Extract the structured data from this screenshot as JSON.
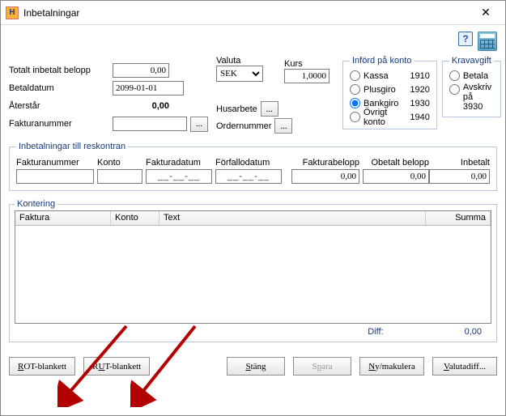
{
  "window": {
    "title": "Inbetalningar"
  },
  "labels": {
    "totalt": "Totalt inbetalt belopp",
    "betaldatum": "Betaldatum",
    "aterstar": "Återstår",
    "fakturanummer": "Fakturanummer",
    "valuta": "Valuta",
    "kurs": "Kurs",
    "husarbete": "Husarbete",
    "ordernummer": "Ordernummer"
  },
  "values": {
    "totalt": "0,00",
    "betaldatum": "2099-01-01",
    "aterstar": "0,00",
    "fakturanummer": "",
    "valuta": "SEK",
    "kurs": "1,0000"
  },
  "inford": {
    "legend": "Införd på konto",
    "options": [
      {
        "label": "Kassa",
        "acct": "1910",
        "checked": false
      },
      {
        "label": "Plusgiro",
        "acct": "1920",
        "checked": false
      },
      {
        "label": "Bankgiro",
        "acct": "1930",
        "checked": true
      },
      {
        "label": "Övrigt konto",
        "acct": "1940",
        "checked": false
      }
    ]
  },
  "kravavgift": {
    "legend": "Kravavgift",
    "betala": "Betala",
    "avskriv": "Avskriv på 3930"
  },
  "reskontra": {
    "legend": "Inbetalningar till reskontran",
    "headers": {
      "fn": "Fakturanummer",
      "konto": "Konto",
      "fd": "Fakturadatum",
      "ff": "Förfallodatum",
      "fb": "Fakturabelopp",
      "ob": "Obetalt belopp",
      "ib": "Inbetalt"
    },
    "row": {
      "fn": "",
      "konto": "",
      "fd": "__-__-__",
      "ff": "__-__-__",
      "fb": "0,00",
      "ob": "0,00",
      "ib": "0,00"
    }
  },
  "kontering": {
    "legend": "Kontering",
    "headers": {
      "faktura": "Faktura",
      "konto": "Konto",
      "text": "Text",
      "summa": "Summa"
    },
    "diff_label": "Diff:",
    "diff_value": "0,00"
  },
  "buttons": {
    "rot": "ROT-blankett",
    "rut": "RUT-blankett",
    "stang": "Stäng",
    "spara": "Spara",
    "nymak": "Ny/makulera",
    "valuta": "Valutadiff..."
  },
  "accel": {
    "r": "R",
    "u": "U",
    "s": "S",
    "p": "p",
    "n": "N",
    "v": "V"
  }
}
